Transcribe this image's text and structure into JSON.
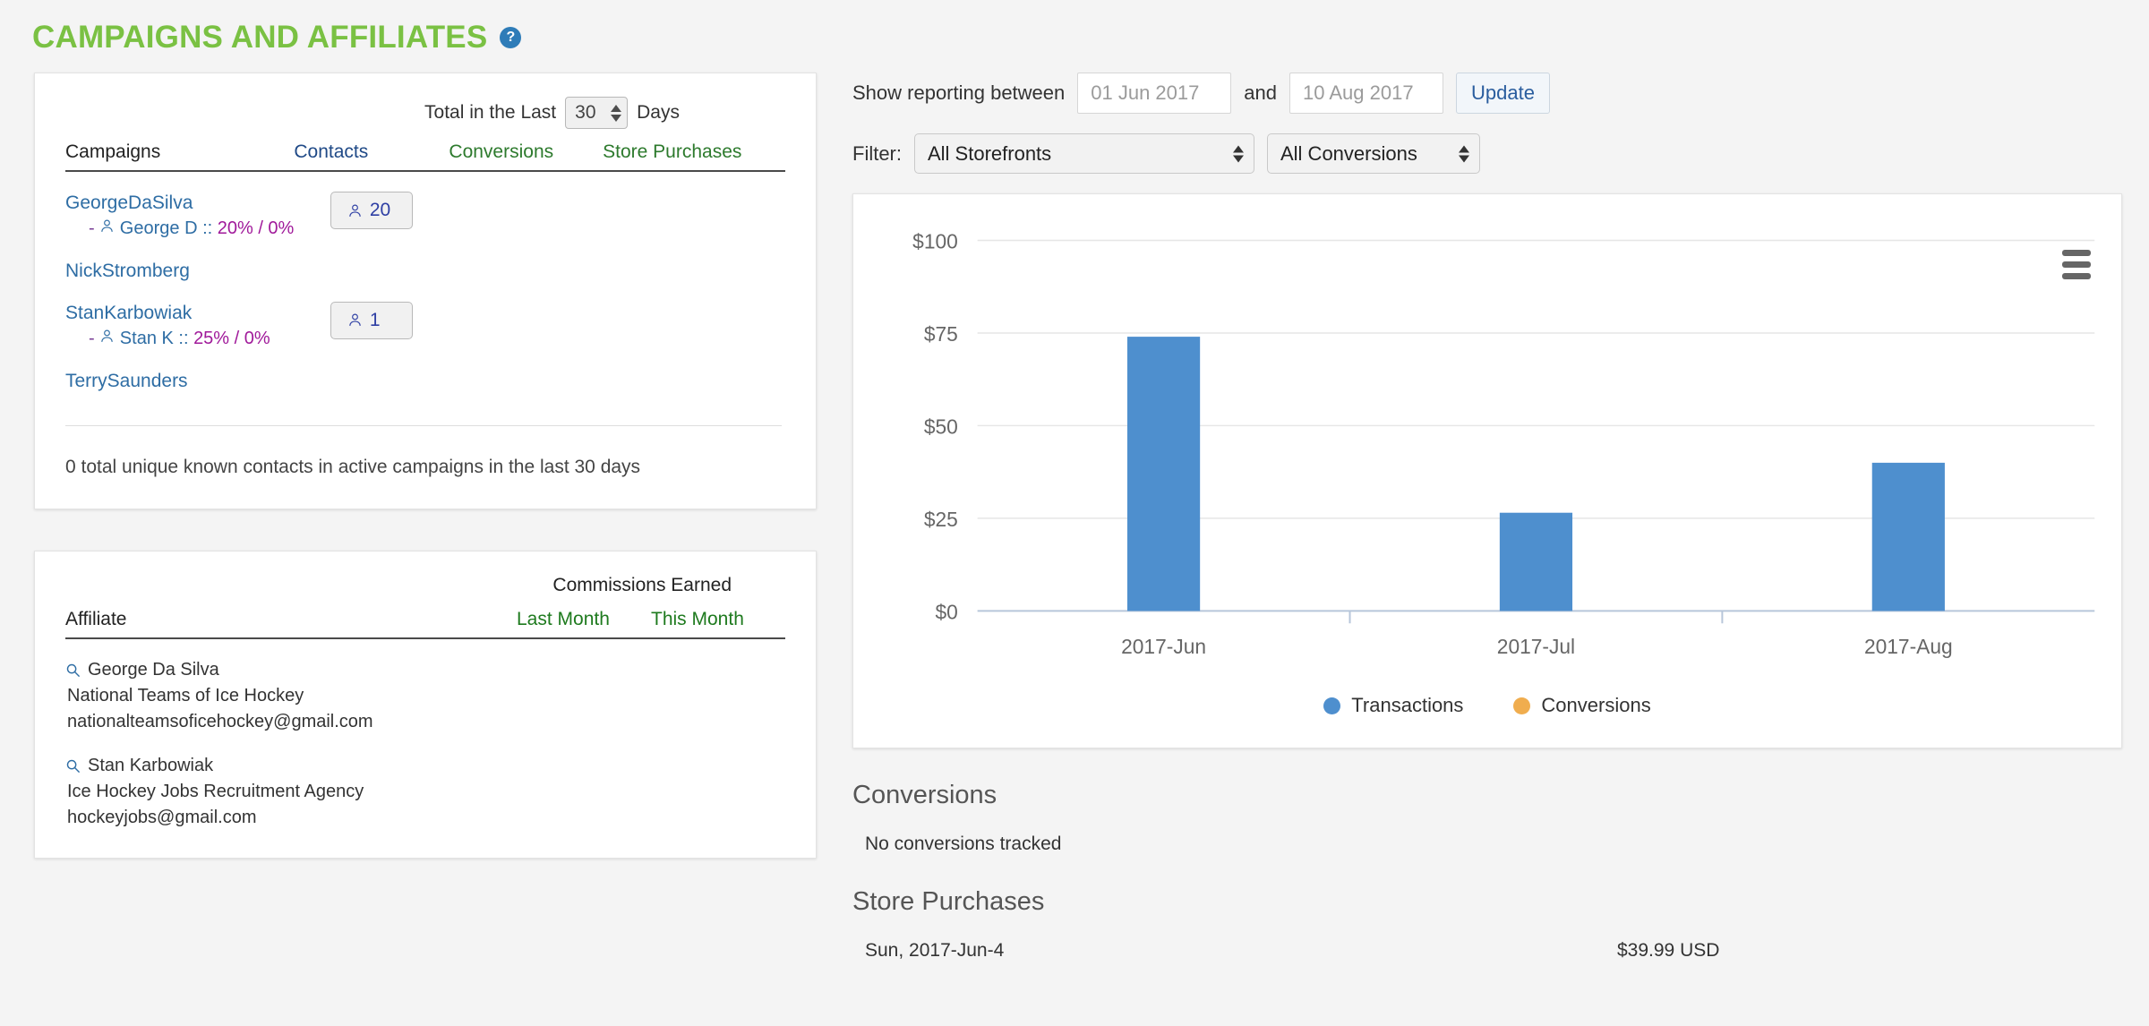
{
  "header": {
    "title": "CAMPAIGNS AND AFFILIATES",
    "help_icon": "question-mark-icon",
    "help_label": "?"
  },
  "campaigns_panel": {
    "totals_prefix": "Total in the Last",
    "totals_value": "30",
    "totals_suffix": "Days",
    "columns": {
      "campaigns": "Campaigns",
      "contacts": "Contacts",
      "conversions": "Conversions",
      "store_purchases": "Store Purchases"
    },
    "rows": [
      {
        "name": "GeorgeDaSilva",
        "sub": "George D :: 20% / 0%",
        "sub_dash": "-",
        "sub_name": "George D :: ",
        "sub_pct": "20% / 0%",
        "contacts": "20",
        "has_contacts": true
      },
      {
        "name": "NickStromberg",
        "sub": "",
        "contacts": "",
        "has_contacts": false
      },
      {
        "name": "StanKarbowiak",
        "sub": "Stan K :: 25% / 0%",
        "sub_dash": "-",
        "sub_name": "Stan K :: ",
        "sub_pct": "25% / 0%",
        "contacts": "1",
        "has_contacts": true
      },
      {
        "name": "TerrySaunders",
        "sub": "",
        "contacts": "",
        "has_contacts": false
      }
    ],
    "footer": "0 total unique known contacts in active campaigns in the last 30 days"
  },
  "affiliates_panel": {
    "commissions_header": "Commissions Earned",
    "columns": {
      "affiliate": "Affiliate",
      "last_month": "Last Month",
      "this_month": "This Month"
    },
    "rows": [
      {
        "name": "George Da Silva",
        "company": "National Teams of Ice Hockey",
        "email": "nationalteamsoficehockey@gmail.com",
        "last_month": "",
        "this_month": ""
      },
      {
        "name": "Stan Karbowiak",
        "company": "Ice Hockey Jobs Recruitment Agency",
        "email": "hockeyjobs@gmail.com",
        "last_month": "",
        "this_month": ""
      }
    ]
  },
  "reporting": {
    "label": "Show reporting between",
    "start_date": "01 Jun 2017",
    "between_word": "and",
    "end_date": "10 Aug 2017",
    "update_label": "Update",
    "filter_label": "Filter:",
    "storefront_selected": "All Storefronts",
    "conversions_selected": "All Conversions"
  },
  "chart_data": {
    "type": "bar",
    "title": "",
    "categories": [
      "2017-Jun",
      "2017-Jul",
      "2017-Aug"
    ],
    "series": [
      {
        "name": "Transactions",
        "color": "#4e8fce",
        "values": [
          74,
          26.5,
          39.99
        ]
      },
      {
        "name": "Conversions",
        "color": "#f0ad4e",
        "values": [
          0,
          0,
          0
        ]
      }
    ],
    "ylabel": "",
    "xlabel": "",
    "ylim": [
      0,
      100
    ],
    "yticks": [
      0,
      25,
      50,
      75,
      100
    ],
    "ytick_labels": [
      "$0",
      "$25",
      "$50",
      "$75",
      "$100"
    ],
    "grid": true,
    "legend_position": "bottom",
    "menu_icon": "hamburger-menu-icon"
  },
  "conversions_section": {
    "title": "Conversions",
    "empty_text": "No conversions tracked"
  },
  "store_purchases_section": {
    "title": "Store Purchases",
    "rows": [
      {
        "date": "Sun, 2017-Jun-4",
        "amount": "$39.99 USD"
      }
    ]
  },
  "colors": {
    "brand_green": "#7ac143",
    "link_blue": "#2e6da4",
    "bar_blue": "#4e8fce",
    "conv_orange": "#f0ad4e"
  }
}
